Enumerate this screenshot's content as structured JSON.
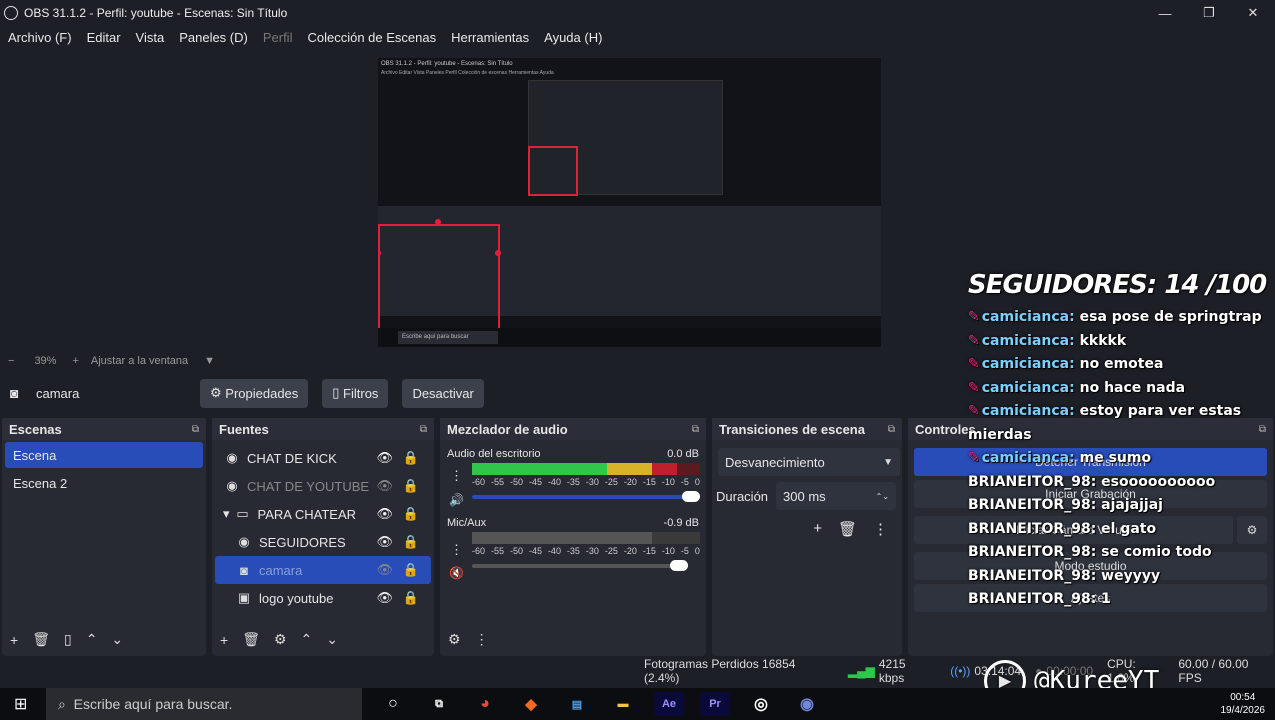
{
  "window": {
    "title": "OBS 31.1.2 - Perfil: youtube - Escenas: Sin Título",
    "min": "—",
    "max": "❐",
    "close": "✕"
  },
  "menu": [
    "Archivo (F)",
    "Editar",
    "Vista",
    "Paneles (D)",
    "Perfil",
    "Colección de Escenas",
    "Herramientas",
    "Ayuda (H)"
  ],
  "preview": {
    "inner_title": "OBS 31.1.2 - Perfil: youtube - Escenas: Sin Título",
    "inner_menu": "Archivo  Editar  Vista  Paneles  Perfil  Colección de escenas  Herramientas  Ayuda",
    "inner_search": "Escribe aquí para buscar",
    "inner_status": "Fotogramas Perdidos 16854 (2.4%)   4215 kbps   03:14:04"
  },
  "zoom": {
    "minus": "−",
    "value": "39%",
    "plus": "+",
    "fit": "Ajustar a la ventana",
    "arrow": "▼"
  },
  "context": {
    "source": "camara",
    "props": "Propiedades",
    "filters": "Filtros",
    "deactivate": "Desactivar"
  },
  "scenes": {
    "title": "Escenas",
    "items": [
      "Escena",
      "Escena 2"
    ]
  },
  "sources": {
    "title": "Fuentes",
    "items": [
      {
        "name": "CHAT DE KICK",
        "icon": "◉"
      },
      {
        "name": "CHAT DE YOUTUBE",
        "icon": "◉"
      },
      {
        "name": "PARA CHATEAR",
        "icon": "▭"
      },
      {
        "name": "SEGUIDORES",
        "icon": "◉"
      },
      {
        "name": "camara",
        "icon": "◙"
      },
      {
        "name": "logo youtube",
        "icon": "▣"
      }
    ]
  },
  "mixer": {
    "title": "Mezclador de audio",
    "ch1": {
      "name": "Audio del escritorio",
      "db": "0.0 dB"
    },
    "ch2": {
      "name": "Mic/Aux",
      "db": "-0.9 dB"
    },
    "scale": [
      "-60",
      "-55",
      "-50",
      "-45",
      "-40",
      "-35",
      "-30",
      "-25",
      "-20",
      "-15",
      "-10",
      "-5",
      "0"
    ]
  },
  "transitions": {
    "title": "Transiciones de escena",
    "type": "Desvanecimiento",
    "duration_label": "Duración",
    "duration": "300 ms"
  },
  "controls": {
    "title": "Controles",
    "stream": "Detener Transmisión",
    "record": "Iniciar Grabación",
    "vcam": "Iniciar Cámara Virtual",
    "studio": "Modo estudio",
    "settings": "Ajustes"
  },
  "status": {
    "dropped": "Fotogramas Perdidos 16854 (2.4%)",
    "kbps": "4215 kbps",
    "live_time": "03:14:04",
    "rec_time": "00:00:00",
    "cpu": "CPU: 1.6%",
    "fps": "60.00 / 60.00 FPS"
  },
  "taskbar": {
    "search": "Escribe aquí para buscar.",
    "time": "00:54",
    "date": "19/4/2026"
  },
  "overlay": {
    "followers": "SEGUIDORES: 14 /100",
    "chat": [
      {
        "user": "camiciancа:",
        "msg": "esa pose de springtrap",
        "badge": true
      },
      {
        "user": "camiciancа:",
        "msg": "kkkkk",
        "badge": true
      },
      {
        "user": "camiciancа:",
        "msg": "no emotea",
        "badge": true
      },
      {
        "user": "camiciancа:",
        "msg": "no hace nada",
        "badge": true
      },
      {
        "user": "camiciancа:",
        "msg": "estoy para ver estas mierdas",
        "badge": true
      },
      {
        "user": "camiciancа:",
        "msg": "me sumo",
        "badge": true
      },
      {
        "user": "BRIANEITOR_98:",
        "msg": "esoooooooooo",
        "badge": false
      },
      {
        "user": "BRIANEITOR_98:",
        "msg": "ajajajjaj",
        "badge": false
      },
      {
        "user": "BRIANEITOR_98:",
        "msg": "el gato",
        "badge": false
      },
      {
        "user": "BRIANEITOR_98:",
        "msg": "se comio todo",
        "badge": false
      },
      {
        "user": "BRIANEITOR_98:",
        "msg": "weyyyy",
        "badge": false
      },
      {
        "user": "BRIANEITOR_98:",
        "msg": "1",
        "badge": false
      }
    ],
    "brand": "@KureeYT"
  }
}
